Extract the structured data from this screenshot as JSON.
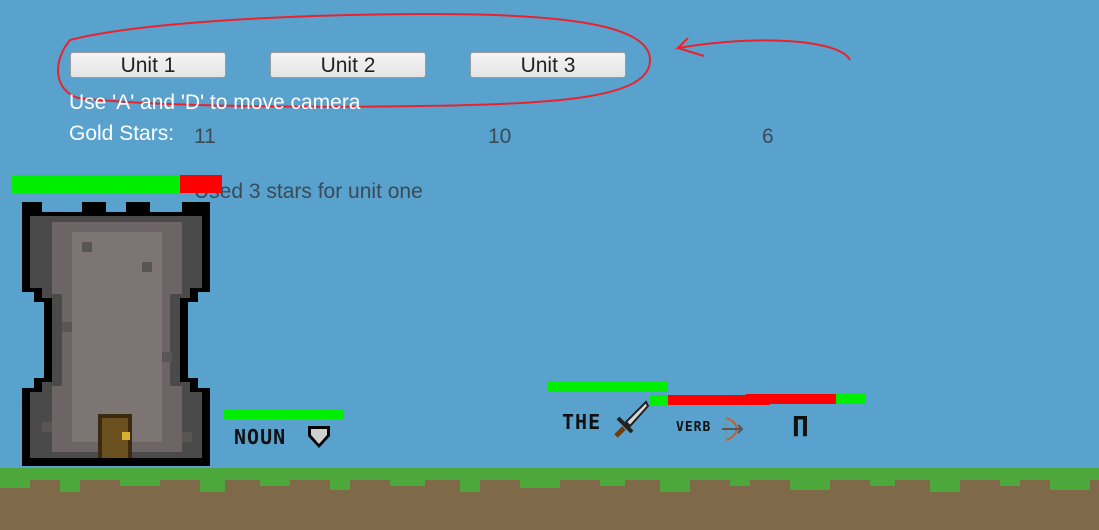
{
  "hud": {
    "buttons": [
      {
        "label": "Unit 1"
      },
      {
        "label": "Unit 2"
      },
      {
        "label": "Unit 3"
      }
    ],
    "camera_hint": "Use 'A' and 'D' to move camera",
    "gold_label": "Gold Stars:",
    "costs": [
      "11",
      "10",
      "6"
    ],
    "status_message": "Used 3 stars for unit one"
  },
  "units": [
    {
      "label": "NOUN",
      "icon": "shield-icon",
      "health": 1.0
    },
    {
      "label": "THE",
      "icon": "sword-icon",
      "health": 1.0
    },
    {
      "label": "VERB",
      "icon": "bow-icon",
      "health": 0.15
    },
    {
      "label": "Π",
      "icon": "pi-icon",
      "health": 0.25
    }
  ],
  "tower": {
    "health": 0.8
  },
  "colors": {
    "sky": "#58a2cd",
    "health_full": "#00ee00",
    "health_missing": "#ff0000",
    "grass": "#4ca83a",
    "dirt": "#7e6a49",
    "annotation": "#e8232e"
  }
}
